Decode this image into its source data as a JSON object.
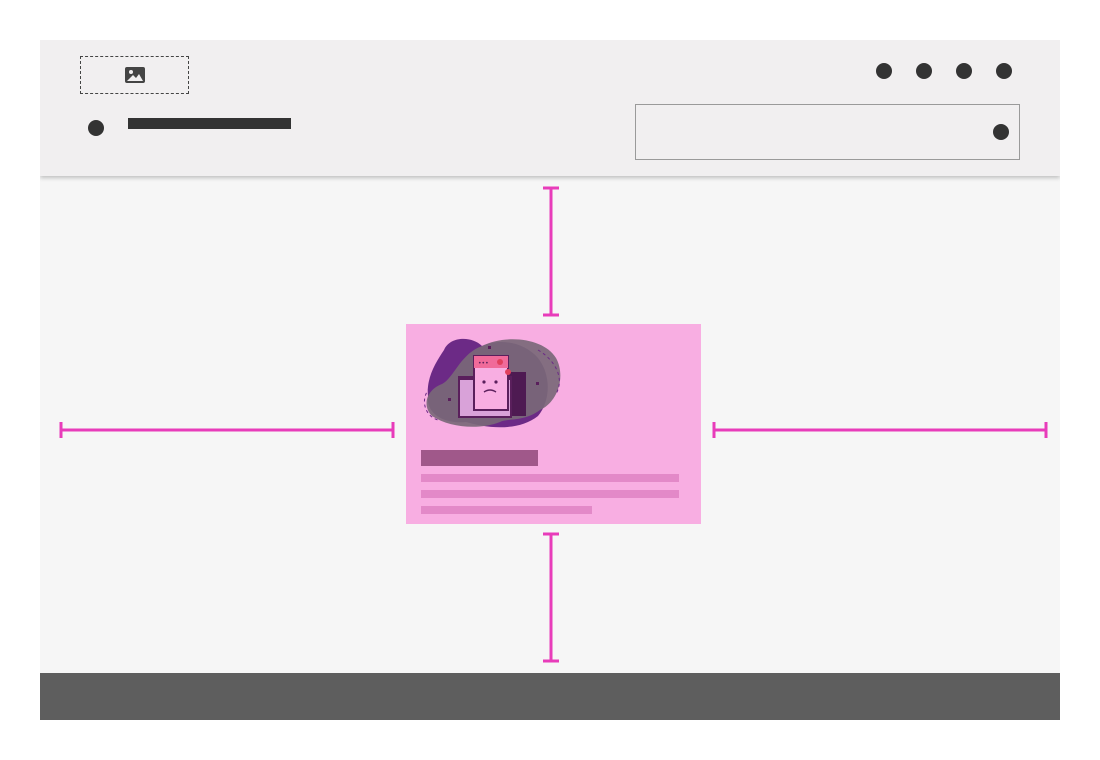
{
  "header": {
    "logo_icon": "image-icon",
    "nav_icons": [
      "nav-dot-1",
      "nav-dot-2",
      "nav-dot-3",
      "nav-dot-4"
    ],
    "menu_icon": "menu-dot",
    "search_icon": "search-dot"
  },
  "card": {
    "illustration": "sad-browser-window-illustration"
  },
  "colors": {
    "header_bg": "#f1eff0",
    "page_bg": "#f6f6f6",
    "card_bg": "#f8aee2",
    "card_title": "#a0588a",
    "card_lines": "#e389c8",
    "spacing_marker": "#e83cba",
    "footer_bg": "#5e5e5e",
    "dark": "#333333"
  }
}
